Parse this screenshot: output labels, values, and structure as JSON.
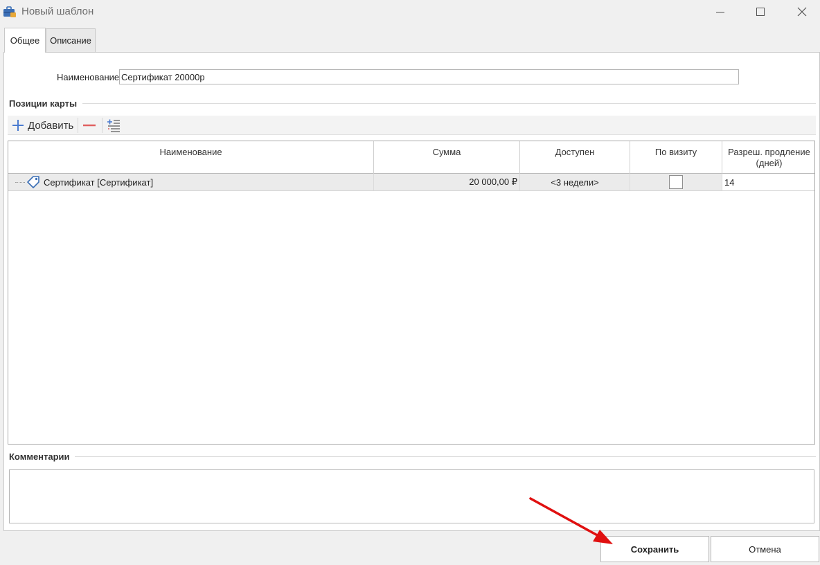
{
  "window": {
    "title": "Новый шаблон"
  },
  "tabs": [
    {
      "label": "Общее",
      "active": true
    },
    {
      "label": "Описание",
      "active": false
    }
  ],
  "form": {
    "name_label": "Наименование:",
    "name_value": "Сертификат 20000р"
  },
  "positions": {
    "header": "Позиции карты",
    "toolbar": {
      "add_label": "Добавить",
      "icons": [
        "plus-icon",
        "minus-icon",
        "expand-list-icon"
      ]
    },
    "columns": [
      {
        "label": "Наименование"
      },
      {
        "label": "Сумма"
      },
      {
        "label": "Доступен"
      },
      {
        "label": "По визиту"
      },
      {
        "label": "Разреш. продление (дней)"
      }
    ],
    "rows": [
      {
        "name": "Сертификат [Сертификат]",
        "sum": "20 000,00 ₽",
        "available": "<3 недели>",
        "per_visit": false,
        "extension_days": "14"
      }
    ]
  },
  "comments": {
    "header": "Комментарии",
    "value": ""
  },
  "buttons": {
    "save": "Сохранить",
    "cancel": "Отмена"
  },
  "colors": {
    "accent_blue": "#4a7bd0",
    "remove_red": "#e06060",
    "arrow_red": "#e01010"
  }
}
